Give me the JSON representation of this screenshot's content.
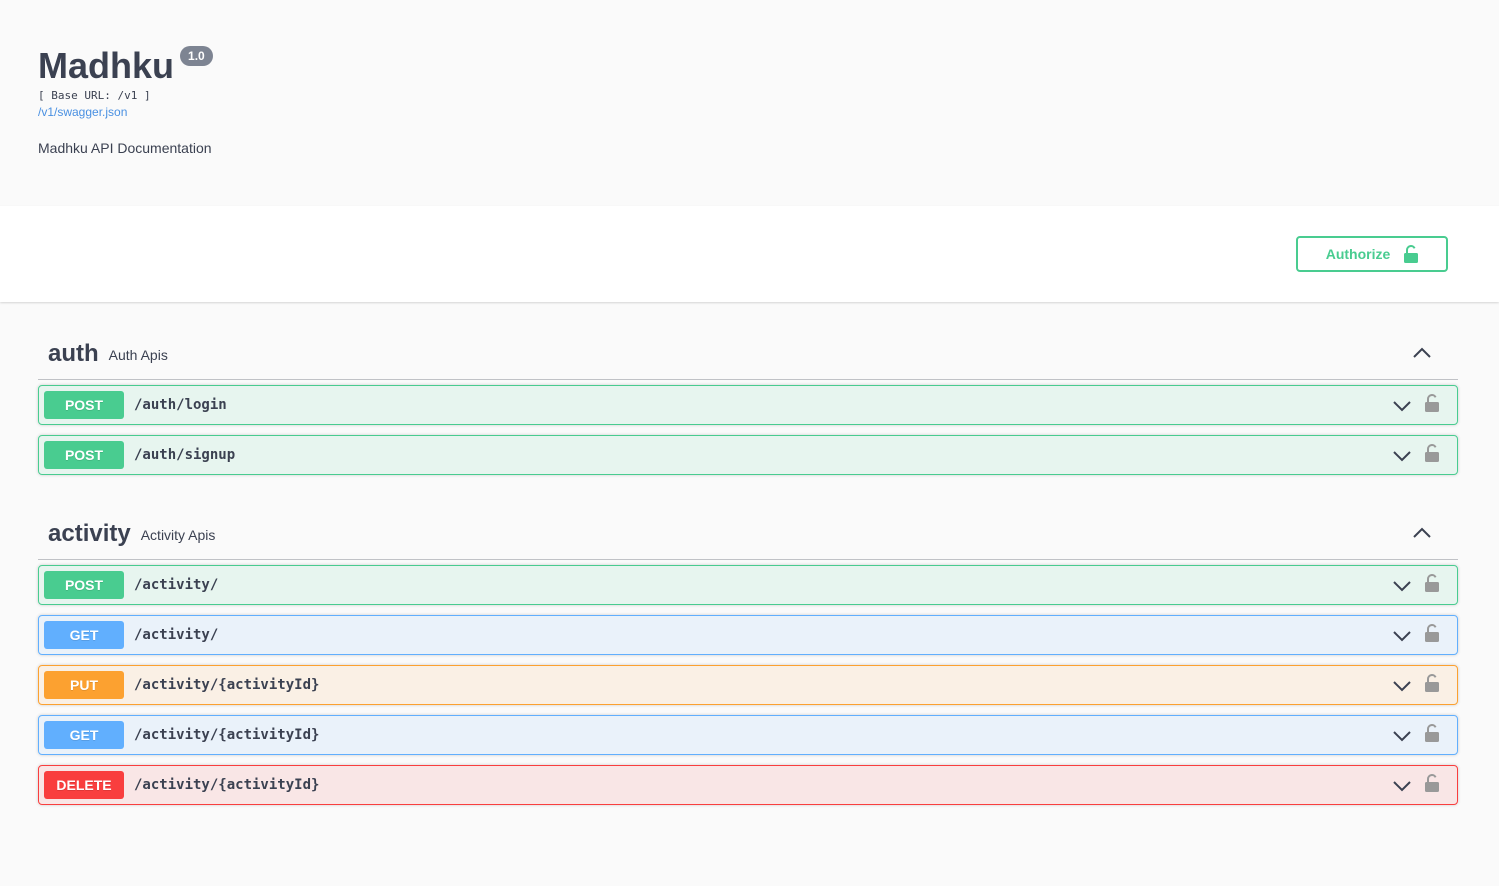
{
  "info": {
    "title": "Madhku",
    "version": "1.0",
    "base_url": "[ Base URL: /v1 ]",
    "spec_link": "/v1/swagger.json",
    "description": "Madhku API Documentation"
  },
  "scheme": {
    "authorize_label": "Authorize",
    "authorize_icon": "unlocked-lock-icon"
  },
  "colors": {
    "post": "#49cc90",
    "get": "#61affe",
    "put": "#fca130",
    "delete": "#f93e3e",
    "text": "#3b4151",
    "link": "#4990e2"
  },
  "tags": [
    {
      "name": "auth",
      "description": "Auth Apis",
      "toggle_icon": "chevron-up-icon",
      "operations": [
        {
          "method": "POST",
          "path": "/auth/login"
        },
        {
          "method": "POST",
          "path": "/auth/signup"
        }
      ]
    },
    {
      "name": "activity",
      "description": "Activity Apis",
      "toggle_icon": "chevron-up-icon",
      "operations": [
        {
          "method": "POST",
          "path": "/activity/"
        },
        {
          "method": "GET",
          "path": "/activity/"
        },
        {
          "method": "PUT",
          "path": "/activity/{activityId}"
        },
        {
          "method": "GET",
          "path": "/activity/{activityId}"
        },
        {
          "method": "DELETE",
          "path": "/activity/{activityId}"
        }
      ]
    }
  ]
}
